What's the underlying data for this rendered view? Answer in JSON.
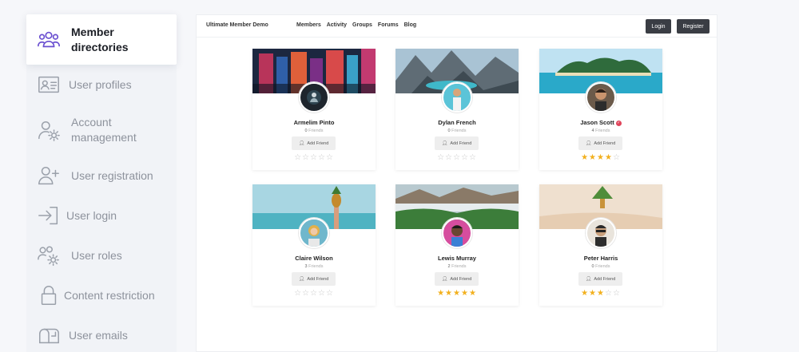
{
  "sidebar": {
    "items": [
      {
        "label": "Member\ndirectories",
        "icon": "users-group-icon",
        "active": true
      },
      {
        "label": "User profiles",
        "icon": "id-card-icon",
        "active": false
      },
      {
        "label": "Account\nmanagement",
        "icon": "user-gear-icon",
        "active": false
      },
      {
        "label": "User registration",
        "icon": "user-plus-icon",
        "active": false
      },
      {
        "label": "User login",
        "icon": "login-arrow-icon",
        "active": false
      },
      {
        "label": "User roles",
        "icon": "users-gear-icon",
        "active": false
      },
      {
        "label": "Content restriction",
        "icon": "lock-icon",
        "active": false
      },
      {
        "label": "User emails",
        "icon": "mailbox-icon",
        "active": false
      }
    ]
  },
  "header": {
    "site_title": "Ultimate Member Demo",
    "nav": [
      "Members",
      "Activity",
      "Groups",
      "Forums",
      "Blog"
    ],
    "login_label": "Login",
    "register_label": "Register"
  },
  "members": [
    {
      "name": "Armelim Pinto",
      "friends_count": "0",
      "friends_label": "Friends",
      "add_friend_label": "Add Friend",
      "rating": 0,
      "verified": false,
      "cover": "city-night"
    },
    {
      "name": "Dylan French",
      "friends_count": "0",
      "friends_label": "Friends",
      "add_friend_label": "Add Friend",
      "rating": 0,
      "verified": false,
      "cover": "mountain-lake"
    },
    {
      "name": "Jason Scott",
      "friends_count": "4",
      "friends_label": "Friends",
      "add_friend_label": "Add Friend",
      "rating": 4,
      "verified": true,
      "cover": "tropical-island"
    },
    {
      "name": "Claire Wilson",
      "friends_count": "3",
      "friends_label": "Friends",
      "add_friend_label": "Add Friend",
      "rating": 0,
      "verified": false,
      "cover": "beach-pineapple"
    },
    {
      "name": "Lewis Murray",
      "friends_count": "2",
      "friends_label": "Friends",
      "add_friend_label": "Add Friend",
      "rating": 5,
      "verified": false,
      "cover": "green-valley"
    },
    {
      "name": "Peter Harris",
      "friends_count": "0",
      "friends_label": "Friends",
      "add_friend_label": "Add Friend",
      "rating": 3,
      "verified": false,
      "cover": "sand-palm"
    }
  ],
  "colors": {
    "star_on": "#f2b01e",
    "star_off": "#c8c8c8",
    "dark_button": "#3a3d44",
    "verified_badge": "#e0445a"
  }
}
